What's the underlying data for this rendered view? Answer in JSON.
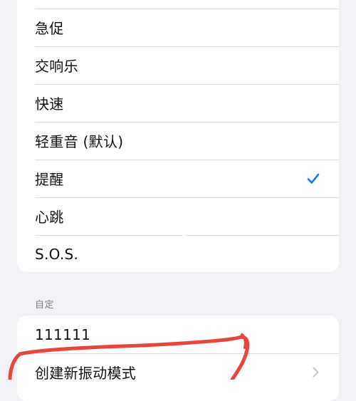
{
  "colors": {
    "background": "#f2f1f6",
    "accent": "#0a7aff",
    "annotation": "#e8453d"
  },
  "patterns": {
    "items": [
      {
        "label": "",
        "selected": false
      },
      {
        "label": "急促",
        "selected": false
      },
      {
        "label": "交响乐",
        "selected": false
      },
      {
        "label": "快速",
        "selected": false
      },
      {
        "label": "轻重音 (默认)",
        "selected": false
      },
      {
        "label": "提醒",
        "selected": true,
        "icon": "checkmark-icon"
      },
      {
        "label": "心跳",
        "selected": false
      },
      {
        "label": "S.O.S.",
        "selected": false
      }
    ]
  },
  "custom": {
    "header": "自定",
    "items": [
      {
        "label": "111111"
      },
      {
        "label": "创建新振动模式",
        "icon": "chevron-right-icon"
      }
    ]
  }
}
